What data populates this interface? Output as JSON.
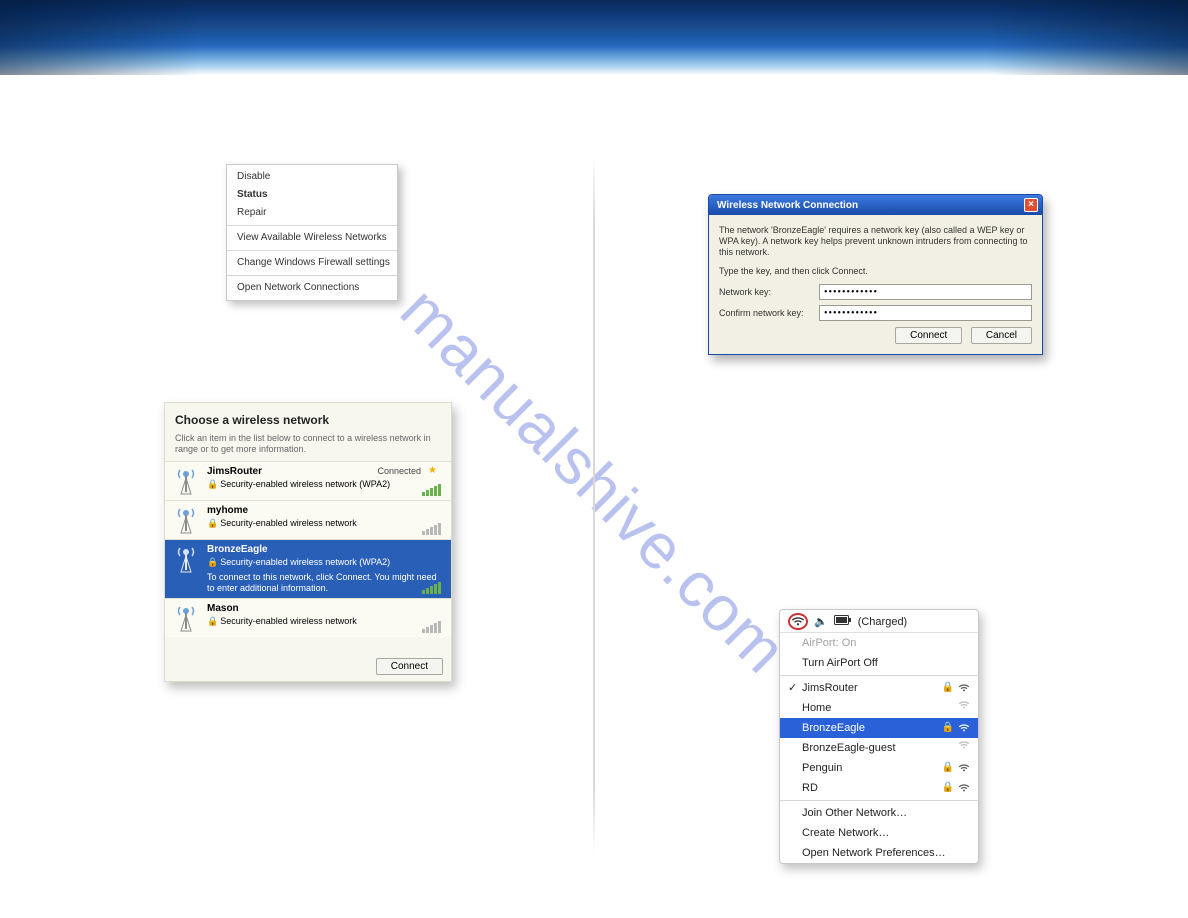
{
  "watermark": "manualshive.com",
  "context_menu": {
    "disable": "Disable",
    "status": "Status",
    "repair": "Repair",
    "view_networks": "View Available Wireless Networks",
    "firewall": "Change Windows Firewall settings",
    "open_conn": "Open Network Connections"
  },
  "choose": {
    "title": "Choose a wireless network",
    "hint": "Click an item in the list below to connect to a wireless network in range or to get more information.",
    "connected": "Connected",
    "connect_btn": "Connect",
    "nets": [
      {
        "name": "JimsRouter",
        "desc": "Security-enabled wireless network (WPA2)"
      },
      {
        "name": "myhome",
        "desc": "Security-enabled wireless network"
      },
      {
        "name": "BronzeEagle",
        "desc": "Security-enabled wireless network (WPA2)",
        "desc2": "To connect to this network, click Connect. You might need to enter additional information."
      },
      {
        "name": "Mason",
        "desc": "Security-enabled wireless network"
      }
    ]
  },
  "xp_dialog": {
    "title": "Wireless Network Connection",
    "intro": "The network 'BronzeEagle' requires a network key (also called a WEP key or WPA key). A network key helps prevent unknown intruders from connecting to this network.",
    "prompt": "Type the key, and then click Connect.",
    "key_label": "Network key:",
    "confirm_label": "Confirm network key:",
    "key_value": "••••••••••••",
    "confirm_value": "••••••••••••",
    "connect": "Connect",
    "cancel": "Cancel"
  },
  "mac": {
    "menubar_status": "(Charged)",
    "airport_on": "AirPort: On",
    "turn_off": "Turn AirPort Off",
    "nets": [
      {
        "name": "JimsRouter",
        "locked": true,
        "check": true
      },
      {
        "name": "Home",
        "locked": false
      },
      {
        "name": "BronzeEagle",
        "locked": true,
        "selected": true
      },
      {
        "name": "BronzeEagle-guest",
        "locked": false
      },
      {
        "name": "Penguin",
        "locked": true
      },
      {
        "name": "RD",
        "locked": true
      }
    ],
    "join_other": "Join Other Network…",
    "create_net": "Create Network…",
    "open_prefs": "Open Network Preferences…"
  }
}
